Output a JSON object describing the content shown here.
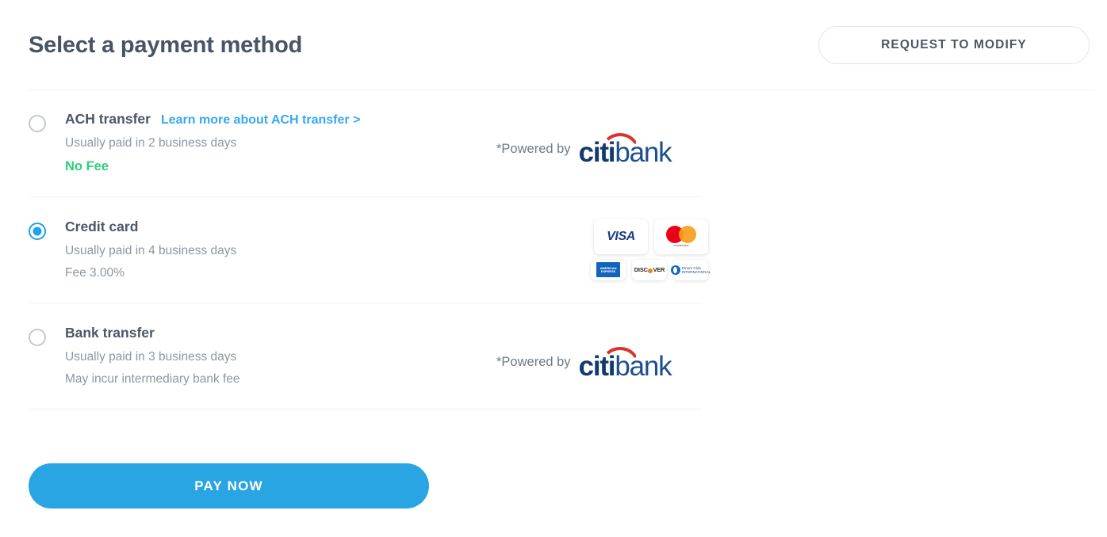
{
  "header": {
    "title": "Select a payment method",
    "modify_button": "REQUEST TO MODIFY"
  },
  "options": [
    {
      "id": "ach-transfer",
      "title": "ACH transfer",
      "link": "Learn more about ACH transfer >",
      "subtitle": "Usually paid in 2 business days",
      "fee": "No Fee",
      "fee_style": "free",
      "selected": false,
      "logo": "citibank",
      "powered_label": "*Powered by"
    },
    {
      "id": "credit-card",
      "title": "Credit card",
      "link": "",
      "subtitle": "Usually paid in 4 business days",
      "fee": "Fee 3.00%",
      "fee_style": "normal",
      "selected": true,
      "logo": "card-brands",
      "powered_label": ""
    },
    {
      "id": "bank-transfer",
      "title": "Bank transfer",
      "link": "",
      "subtitle": "Usually paid in 3 business days",
      "fee": "May incur intermediary bank fee",
      "fee_style": "normal",
      "selected": false,
      "logo": "citibank",
      "powered_label": "*Powered by"
    }
  ],
  "citibank": {
    "citi": "citi",
    "bank": "bank"
  },
  "card_brands": {
    "visa": "VISA",
    "mastercard": "mastercard",
    "amex": "AMERICAN EXPRESS",
    "discover": "DISCOVER",
    "diners_line1": "Diners Club",
    "diners_line2": "INTERNATIONAL"
  },
  "pay_button": {
    "label": "PAY NOW"
  },
  "colors": {
    "accent_blue": "#29a5e3",
    "link_blue": "#37a8ef",
    "free_green": "#2fd07c",
    "title_slate": "#4b5667",
    "muted_gray": "#8d96a3",
    "citi_navy": "#123a6d",
    "citi_red": "#d9332c"
  }
}
